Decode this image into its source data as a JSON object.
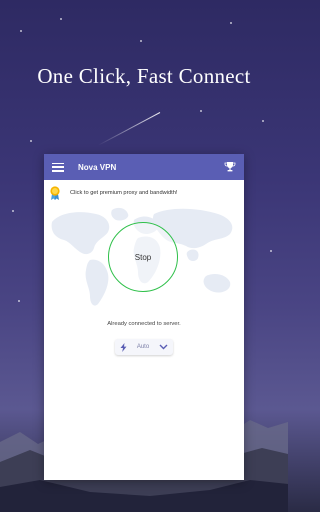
{
  "headline": "One Click, Fast Connect",
  "app": {
    "title": "Nova VPN",
    "promo_text": "Click to get premium proxy and bandwidth!",
    "connect_button": "Stop",
    "status_text": "Already connected to server.",
    "server_selector": "Auto"
  },
  "colors": {
    "app_bar": "#5a5eb4",
    "connected_ring": "#2fc04a",
    "selector_icon": "#5a5eb4"
  },
  "icons": [
    "menu-icon",
    "trophy-icon",
    "premium-badge-icon",
    "lightning-icon",
    "chevron-down-icon"
  ]
}
